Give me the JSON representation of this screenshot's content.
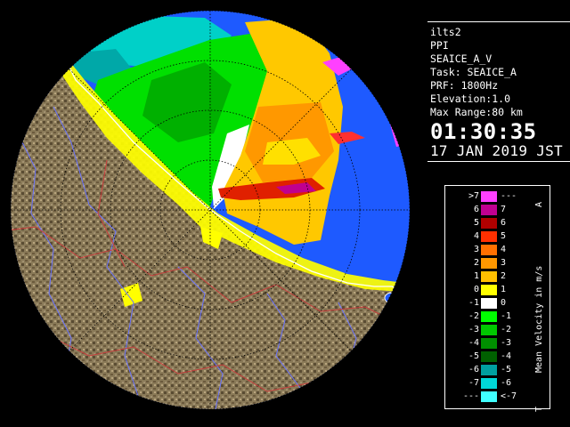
{
  "info": {
    "radar_name": "ilts2",
    "product": "PPI",
    "param": "SEAICE_A_V",
    "task": "Task: SEAICE_A",
    "prf": "PRF: 1800Hz",
    "elevation": "Elevation:1.0",
    "max_range": "Max Range:80 km",
    "time": "01:30:35",
    "date": "17 JAN 2019 JST"
  },
  "legend": {
    "title": "Mean Velocity in m/s",
    "top_mark": "A",
    "bottom_mark": "T",
    "rows": [
      {
        "lo": ">7",
        "hi": "---",
        "color": "#ff40ff"
      },
      {
        "lo": "6",
        "hi": "7",
        "color": "#c00090"
      },
      {
        "lo": "5",
        "hi": "6",
        "color": "#b00000"
      },
      {
        "lo": "4",
        "hi": "5",
        "color": "#ff3000"
      },
      {
        "lo": "3",
        "hi": "4",
        "color": "#ff7000"
      },
      {
        "lo": "2",
        "hi": "3",
        "color": "#ff9800"
      },
      {
        "lo": "1",
        "hi": "2",
        "color": "#ffc000"
      },
      {
        "lo": "0",
        "hi": "1",
        "color": "#ffff00"
      },
      {
        "lo": "-1",
        "hi": "0",
        "color": "#ffffff"
      },
      {
        "lo": "-2",
        "hi": "-1",
        "color": "#00ff00"
      },
      {
        "lo": "-3",
        "hi": "-2",
        "color": "#00c800"
      },
      {
        "lo": "-4",
        "hi": "-3",
        "color": "#009000"
      },
      {
        "lo": "-5",
        "hi": "-4",
        "color": "#006000"
      },
      {
        "lo": "-6",
        "hi": "-5",
        "color": "#00a0a0"
      },
      {
        "lo": "-7",
        "hi": "-6",
        "color": "#00d8d8"
      },
      {
        "lo": "---",
        "hi": "<-7",
        "color": "#40ffff"
      }
    ]
  },
  "colors": {
    "sea": "#1e5aff",
    "land": "#8a7a58",
    "coast": "#ffffff",
    "rivers": "#6a74ff",
    "borders": "#c83c3c"
  }
}
